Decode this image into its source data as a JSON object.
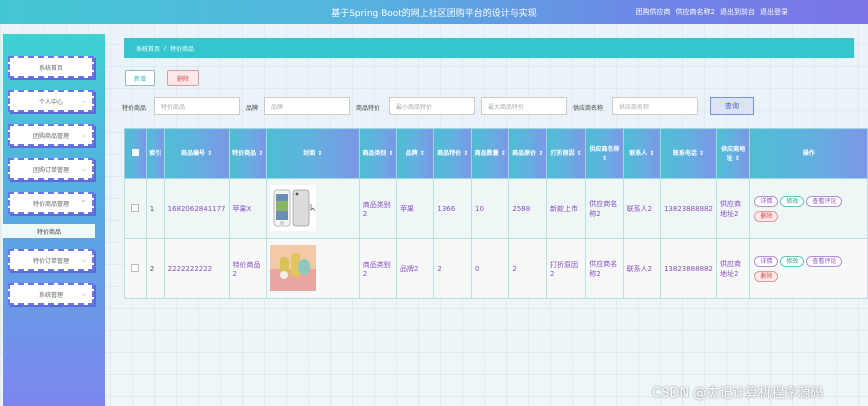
{
  "header": {
    "title": "基于Spring Boot的网上社区团购平台的设计与实现",
    "links": [
      "团购供应商",
      "供应商名称2",
      "退出到前台",
      "退出登录"
    ]
  },
  "sidebar": {
    "items": [
      {
        "label": "系统首页"
      },
      {
        "label": "个人中心"
      },
      {
        "label": "团购商品管理"
      },
      {
        "label": "团购订单管理"
      },
      {
        "label": "特价商品管理"
      },
      {
        "label": "特价订单管理"
      },
      {
        "label": "系统管理"
      }
    ],
    "subitem": "特价商品"
  },
  "breadcrumb": {
    "home": "系统首页",
    "sep": "/",
    "current": "特价商品"
  },
  "toolbar": {
    "add": "新增",
    "delete": "删除"
  },
  "search": {
    "label1": "特价商品",
    "ph1": "特价商品",
    "label2": "品牌",
    "ph2": "品牌",
    "label3": "商品特价",
    "ph3": "最小商品特价",
    "ph4": "最大商品特价",
    "label4": "供应商名称",
    "ph5": "供应商名称",
    "button": "查询"
  },
  "table": {
    "headers": [
      "索引",
      "商品编号",
      "特价商品",
      "封面",
      "商品类别",
      "品牌",
      "商品特价",
      "商品数量",
      "商品原价",
      "打折原因",
      "供应商名称",
      "联系人",
      "联系电话",
      "供应商地址",
      "操作"
    ],
    "rows": [
      {
        "index": "1",
        "code": "1682062841177",
        "name": "苹果X",
        "category": "商品类别2",
        "brand": "苹果",
        "special_price": "1366",
        "qty": "10",
        "orig_price": "2588",
        "reason": "新款上市",
        "supplier": "供应商名称2",
        "contact": "联系人2",
        "phone": "13823888882",
        "address": "供应商地址2"
      },
      {
        "index": "2",
        "code": "2222222222",
        "name": "特价商品2",
        "category": "商品类别2",
        "brand": "品牌2",
        "special_price": "2",
        "qty": "0",
        "orig_price": "2",
        "reason": "打折原因2",
        "supplier": "供应商名称2",
        "contact": "联系人2",
        "phone": "13823888882",
        "address": "供应商地址2"
      }
    ],
    "actions": {
      "detail": "详情",
      "modify": "修改",
      "review": "查看评论",
      "delete": "删除"
    }
  },
  "watermark": "CSDN @杰记计算机程序源码",
  "colors": {
    "accent": "#34c6cf",
    "purple": "#7d74e9",
    "danger": "#d05050"
  }
}
